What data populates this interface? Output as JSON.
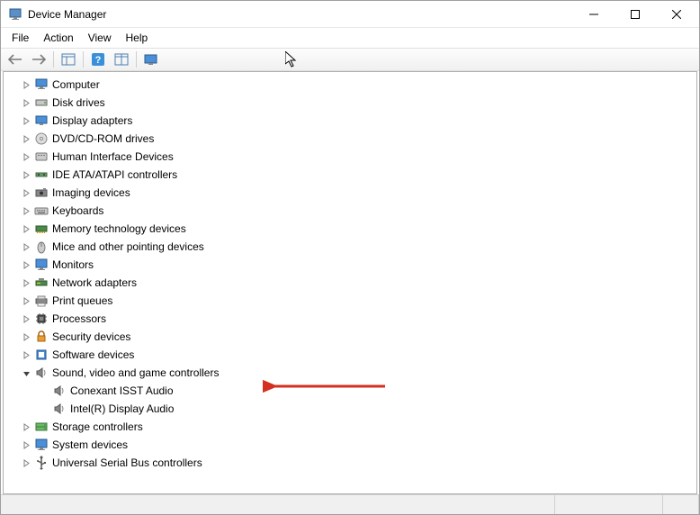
{
  "window": {
    "title": "Device Manager"
  },
  "menu": {
    "items": [
      "File",
      "Action",
      "View",
      "Help"
    ]
  },
  "toolbar": {
    "buttons": [
      "back",
      "forward",
      "sep",
      "show-hidden",
      "sep",
      "help",
      "properties",
      "sep",
      "scan"
    ]
  },
  "tree": {
    "nodes": [
      {
        "label": "Computer",
        "icon": "computer",
        "expanded": false
      },
      {
        "label": "Disk drives",
        "icon": "disk",
        "expanded": false
      },
      {
        "label": "Display adapters",
        "icon": "display",
        "expanded": false
      },
      {
        "label": "DVD/CD-ROM drives",
        "icon": "dvd",
        "expanded": false
      },
      {
        "label": "Human Interface Devices",
        "icon": "hid",
        "expanded": false
      },
      {
        "label": "IDE ATA/ATAPI controllers",
        "icon": "ide",
        "expanded": false
      },
      {
        "label": "Imaging devices",
        "icon": "imaging",
        "expanded": false
      },
      {
        "label": "Keyboards",
        "icon": "keyboard",
        "expanded": false
      },
      {
        "label": "Memory technology devices",
        "icon": "memory",
        "expanded": false
      },
      {
        "label": "Mice and other pointing devices",
        "icon": "mouse",
        "expanded": false
      },
      {
        "label": "Monitors",
        "icon": "monitor",
        "expanded": false
      },
      {
        "label": "Network adapters",
        "icon": "network",
        "expanded": false
      },
      {
        "label": "Print queues",
        "icon": "printer",
        "expanded": false
      },
      {
        "label": "Processors",
        "icon": "cpu",
        "expanded": false
      },
      {
        "label": "Security devices",
        "icon": "security",
        "expanded": false
      },
      {
        "label": "Software devices",
        "icon": "software",
        "expanded": false
      },
      {
        "label": "Sound, video and game controllers",
        "icon": "sound",
        "expanded": true,
        "children": [
          {
            "label": "Conexant ISST Audio",
            "icon": "sound"
          },
          {
            "label": "Intel(R) Display Audio",
            "icon": "sound"
          }
        ]
      },
      {
        "label": "Storage controllers",
        "icon": "storage",
        "expanded": false
      },
      {
        "label": "System devices",
        "icon": "system",
        "expanded": false
      },
      {
        "label": "Universal Serial Bus controllers",
        "icon": "usb",
        "expanded": false
      }
    ]
  },
  "annotation": {
    "target": "Sound, video and game controllers",
    "color": "#d43020"
  }
}
